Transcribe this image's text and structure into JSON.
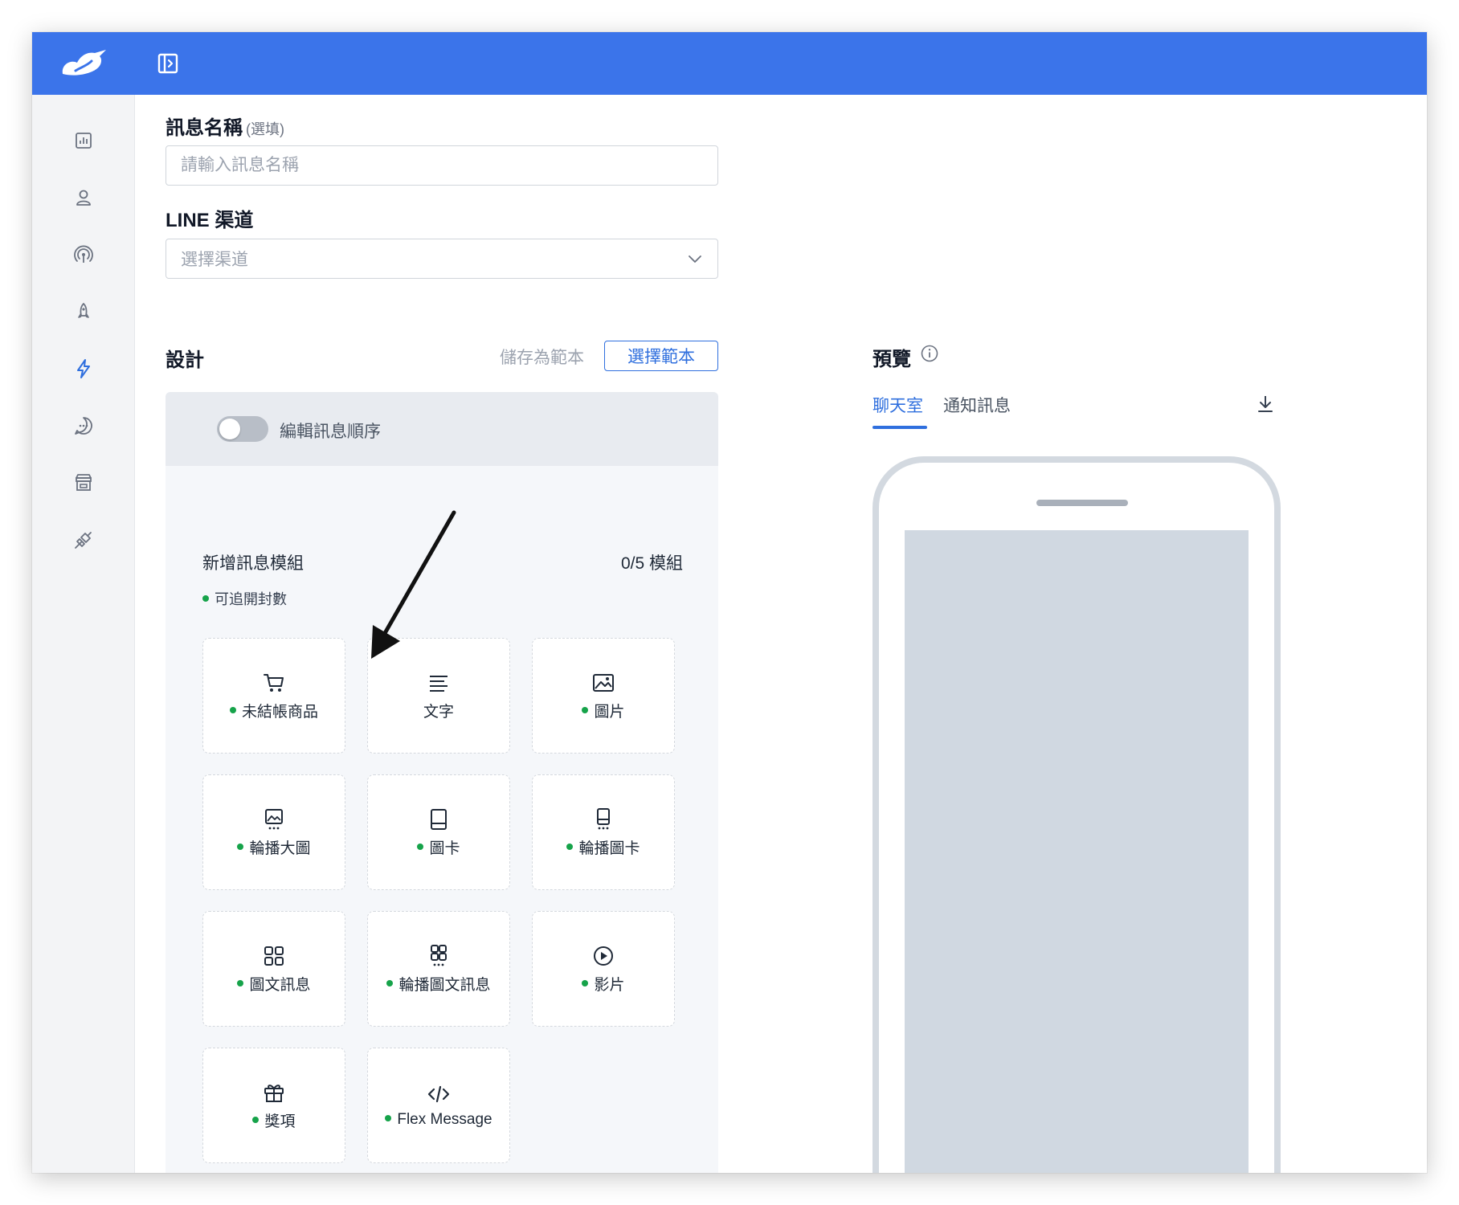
{
  "form": {
    "name_label": "訊息名稱",
    "name_optional": "(選填)",
    "name_placeholder": "請輸入訊息名稱",
    "channel_label": "LINE 渠道",
    "channel_placeholder": "選擇渠道"
  },
  "design": {
    "title": "設計",
    "save_template": "儲存為範本",
    "choose_template": "選擇範本",
    "toggle_label": "編輯訊息順序",
    "add_module_title": "新增訊息模組",
    "module_count": "0/5 模組",
    "trackable_legend": "可追開封數",
    "modules": [
      {
        "label": "未結帳商品",
        "icon": "cart-icon",
        "trackable": true
      },
      {
        "label": "文字",
        "icon": "text-lines-icon",
        "trackable": false
      },
      {
        "label": "圖片",
        "icon": "image-icon",
        "trackable": true
      },
      {
        "label": "輪播大圖",
        "icon": "carousel-image-icon",
        "trackable": true
      },
      {
        "label": "圖卡",
        "icon": "card-icon",
        "trackable": true
      },
      {
        "label": "輪播圖卡",
        "icon": "carousel-card-icon",
        "trackable": true
      },
      {
        "label": "圖文訊息",
        "icon": "grid-icon",
        "trackable": true
      },
      {
        "label": "輪播圖文訊息",
        "icon": "carousel-grid-icon",
        "trackable": true
      },
      {
        "label": "影片",
        "icon": "play-icon",
        "trackable": true
      },
      {
        "label": "獎項",
        "icon": "gift-icon",
        "trackable": true
      },
      {
        "label": "Flex Message",
        "icon": "code-icon",
        "trackable": true
      }
    ]
  },
  "preview": {
    "title": "預覽",
    "tabs": [
      {
        "label": "聊天室",
        "active": true
      },
      {
        "label": "通知訊息",
        "active": false
      }
    ]
  },
  "sidebar": {
    "icons": [
      "dashboard-icon",
      "user-icon",
      "broadcast-icon",
      "rocket-icon",
      "lightning-icon",
      "chat-icon",
      "store-icon",
      "plug-icon"
    ]
  },
  "colors": {
    "header": "#3b74ea",
    "accent": "#2f6fde",
    "trackable_dot": "#16a34a"
  }
}
